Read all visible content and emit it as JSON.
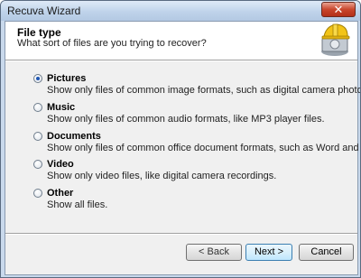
{
  "window": {
    "title": "Recuva Wizard",
    "close_label": "✕"
  },
  "header": {
    "title": "File type",
    "subtitle": "What sort of files are you trying to recover?"
  },
  "options": [
    {
      "label": "Pictures",
      "description": "Show only files of common image formats, such as digital camera photos.",
      "checked": true
    },
    {
      "label": "Music",
      "description": "Show only files of common audio formats, like MP3 player files.",
      "checked": false
    },
    {
      "label": "Documents",
      "description": "Show only files of common office document formats, such as Word and Excel files.",
      "checked": false
    },
    {
      "label": "Video",
      "description": "Show only video files, like digital camera recordings.",
      "checked": false
    },
    {
      "label": "Other",
      "description": "Show all files.",
      "checked": false
    }
  ],
  "buttons": {
    "back": "< Back",
    "next": "Next >",
    "cancel": "Cancel"
  },
  "colors": {
    "accent": "#1f57b3",
    "titlebar": "#bfd3ea",
    "close": "#c9462c"
  },
  "icons": {
    "logo": "recuva-hard-drive-helmet-icon",
    "close": "close-icon"
  }
}
